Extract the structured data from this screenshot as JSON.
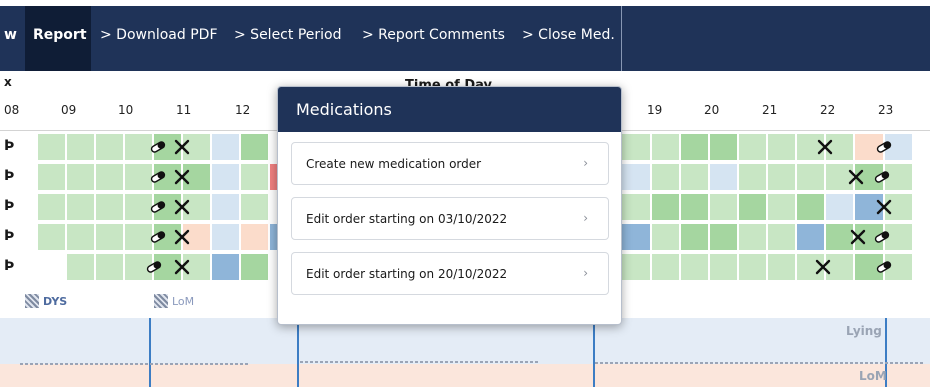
{
  "nav": {
    "cut_label": "w",
    "report_label": "Report",
    "links": [
      "> Download PDF",
      "> Select Period",
      "> Report Comments",
      "> Close Med."
    ]
  },
  "grid": {
    "axis_cut": "x",
    "title": "Time of Day",
    "hours": [
      "08",
      "09",
      "10",
      "11",
      "12",
      "19",
      "20",
      "21",
      "22",
      "23"
    ],
    "row_icon": "Ϸ"
  },
  "legend": {
    "dys": "DYS",
    "lom": "LoM"
  },
  "band": {
    "lying": "Lying",
    "lom": "LoM"
  },
  "modal": {
    "title": "Medications",
    "buttons": [
      "Create new medication order",
      "Edit order starting on 03/10/2022",
      "Edit order starting on 20/10/2022"
    ],
    "chevron": "›"
  },
  "icons": {
    "pill": "pill-icon",
    "utensils": "utensils-icon"
  },
  "colors": {
    "nav_bg": "#1f3358",
    "nav_active": "#0f1d36",
    "cell_green_light": "#c8e6c4",
    "cell_green": "#a5d6a0",
    "cell_blue": "#d5e4f2",
    "cell_blue_dark": "#8fb5d9",
    "cell_peach": "#fbdccb",
    "cell_red": "#f08080"
  }
}
